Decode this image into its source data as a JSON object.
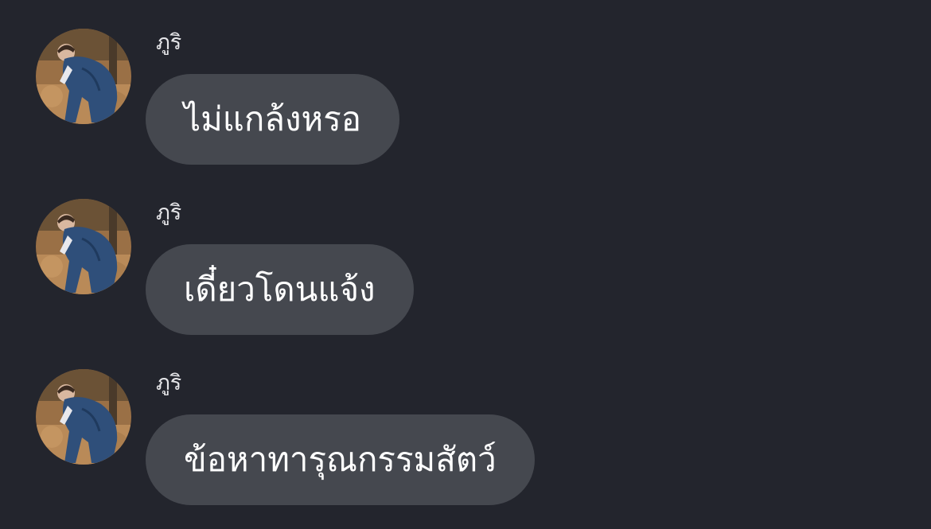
{
  "conversation": {
    "messages": [
      {
        "sender": "ภูริ",
        "avatar_icon": "user-photo-avatar",
        "text": "ไม่แกล้งหรอ"
      },
      {
        "sender": "ภูริ",
        "avatar_icon": "user-photo-avatar",
        "text": "เดี๋ยวโดนแจ้ง"
      },
      {
        "sender": "ภูริ",
        "avatar_icon": "user-photo-avatar",
        "text": "ข้อหาทารุณกรรมสัตว์"
      }
    ]
  },
  "colors": {
    "background": "#23252d",
    "bubble": "#45484f",
    "message_text": "#ffffff",
    "sender_text": "#e6e6e9"
  }
}
